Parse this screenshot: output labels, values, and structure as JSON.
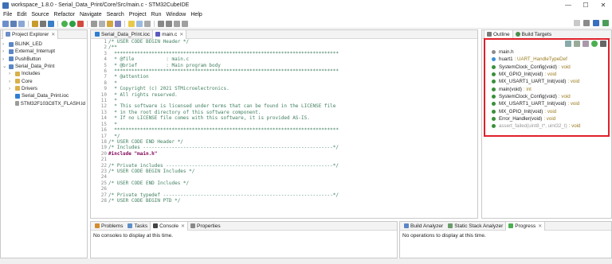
{
  "window": {
    "title": "workspace_1.8.0 - Serial_Data_Print/Core/Src/main.c - STM32CubeIDE",
    "controls": [
      "—",
      "☐",
      "✕"
    ]
  },
  "menu": [
    "File",
    "Edit",
    "Source",
    "Refactor",
    "Navigate",
    "Search",
    "Project",
    "Run",
    "Window",
    "Help"
  ],
  "project_explorer": {
    "tab": "Project Explorer",
    "items": [
      {
        "label": "BLINK_LED",
        "depth": 0,
        "kind": "project"
      },
      {
        "label": "External_Interrupt",
        "depth": 0,
        "kind": "project"
      },
      {
        "label": "PushButton",
        "depth": 0,
        "kind": "project"
      },
      {
        "label": "Serial_Data_Print",
        "depth": 0,
        "kind": "project"
      },
      {
        "label": "Includes",
        "depth": 1,
        "kind": "folder"
      },
      {
        "label": "Core",
        "depth": 1,
        "kind": "folder"
      },
      {
        "label": "Drivers",
        "depth": 1,
        "kind": "folder"
      },
      {
        "label": "Serial_Data_Print.ioc",
        "depth": 1,
        "kind": "file"
      },
      {
        "label": "STM32F103C8TX_FLASH.ld",
        "depth": 1,
        "kind": "file"
      }
    ]
  },
  "editor": {
    "tabs": [
      {
        "label": "Serial_Data_Print.ioc",
        "active": false
      },
      {
        "label": "main.c",
        "active": true
      }
    ],
    "gutter": [
      "1",
      "2",
      "3",
      "4",
      "5",
      "6",
      "7",
      "8",
      "9",
      "10",
      "11",
      "12",
      "13",
      "14",
      "15",
      "16",
      "17",
      "18",
      "19",
      "20",
      "21",
      "22",
      "23",
      "24",
      "25",
      "26",
      "27",
      "28"
    ],
    "lines": [
      "/* USER CODE BEGIN Header */",
      "/**",
      "  ******************************************************************************",
      "  * @file           : main.c",
      "  * @brief          : Main program body",
      "  ******************************************************************************",
      "  * @attention",
      "  *",
      "  * Copyright (c) 2021 STMicroelectronics.",
      "  * All rights reserved.",
      "  *",
      "  * This software is licensed under terms that can be found in the LICENSE file",
      "  * in the root directory of this software component.",
      "  * If no LICENSE file comes with this software, it is provided AS-IS.",
      "  *",
      "  ******************************************************************************",
      "  */",
      "/* USER CODE END Header */",
      "/* Includes ------------------------------------------------------------------*/",
      "#include \"main.h\"",
      "",
      "/* Private includes ----------------------------------------------------------*/",
      "/* USER CODE BEGIN Includes */",
      "",
      "/* USER CODE END Includes */",
      "",
      "/* Private typedef -----------------------------------------------------------*/",
      "/* USER CODE BEGIN PTD */"
    ]
  },
  "outline": {
    "tabs": [
      "Outline",
      "Build Targets"
    ],
    "items": [
      {
        "name": "main.h",
        "type": "",
        "color": "#8c8c8c"
      },
      {
        "name": "huart1",
        "type": ": UART_HandleTypeDef",
        "color": "#3a8fd6"
      },
      {
        "name": "SystemClock_Config(void)",
        "type": ": void",
        "color": "#3a8f3a"
      },
      {
        "name": "MX_GPIO_Init(void)",
        "type": ": void",
        "color": "#3a8f3a"
      },
      {
        "name": "MX_USART1_UART_Init(void)",
        "type": ": void",
        "color": "#3a8f3a"
      },
      {
        "name": "main(void)",
        "type": ": int",
        "color": "#3a8f3a"
      },
      {
        "name": "SystemClock_Config(void)",
        "type": ": void",
        "color": "#3a8f3a"
      },
      {
        "name": "MX_USART1_UART_Init(void)",
        "type": ": void",
        "color": "#3a8f3a"
      },
      {
        "name": "MX_GPIO_Init(void)",
        "type": ": void",
        "color": "#3a8f3a"
      },
      {
        "name": "Error_Handler(void)",
        "type": ": void",
        "color": "#3a8f3a"
      },
      {
        "name": "assert_failed(uint8_t*, uint32_t)",
        "type": ": void",
        "color": "#3a8f3a"
      }
    ],
    "highlight_color": "#e0202a"
  },
  "console": {
    "tabs": [
      "Problems",
      "Tasks",
      "Console",
      "Properties"
    ],
    "message": "No consoles to display at this time."
  },
  "progress": {
    "tabs": [
      "Build Analyzer",
      "Static Stack Analyzer",
      "Progress"
    ],
    "message": "No operations to display at this time."
  }
}
